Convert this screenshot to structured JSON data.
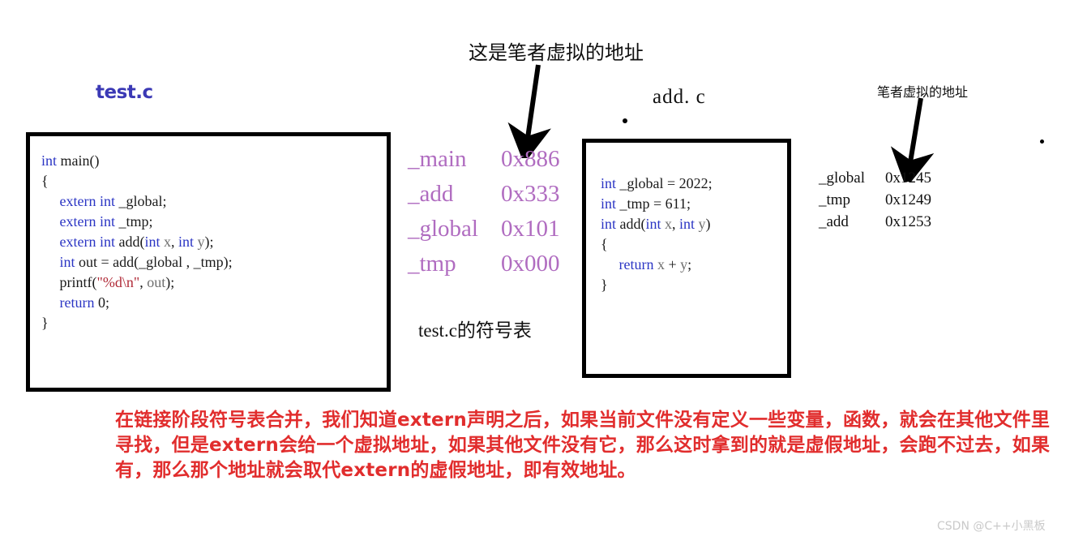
{
  "titles": {
    "left_file": "test.c",
    "right_file": "add. c"
  },
  "annotations": {
    "left_arrow_label": "这是笔者虚拟的地址",
    "right_arrow_label": "笔者虚拟的地址"
  },
  "code_testc": {
    "lines": [
      [
        {
          "t": "int ",
          "c": "kw"
        },
        {
          "t": "main()",
          "c": "pl"
        }
      ],
      [
        {
          "t": "{",
          "c": "pl"
        }
      ],
      [
        {
          "t": "     ",
          "c": "pl"
        },
        {
          "t": "extern int ",
          "c": "kw"
        },
        {
          "t": "_global;",
          "c": "pl"
        }
      ],
      [
        {
          "t": "     ",
          "c": "pl"
        },
        {
          "t": "extern int ",
          "c": "kw"
        },
        {
          "t": "_tmp;",
          "c": "pl"
        }
      ],
      [
        {
          "t": "     ",
          "c": "pl"
        },
        {
          "t": "extern int ",
          "c": "kw"
        },
        {
          "t": "add(",
          "c": "pl"
        },
        {
          "t": "int ",
          "c": "kw"
        },
        {
          "t": "x",
          "c": "var"
        },
        {
          "t": ", ",
          "c": "pl"
        },
        {
          "t": "int ",
          "c": "kw"
        },
        {
          "t": "y",
          "c": "var"
        },
        {
          "t": ");",
          "c": "pl"
        }
      ],
      [
        {
          "t": "     ",
          "c": "pl"
        },
        {
          "t": "int ",
          "c": "kw"
        },
        {
          "t": "out = add(_global , _tmp);",
          "c": "pl"
        }
      ],
      [
        {
          "t": "     ",
          "c": "pl"
        },
        {
          "t": "printf(",
          "c": "pl"
        },
        {
          "t": "\"%d\\n\"",
          "c": "str"
        },
        {
          "t": ", ",
          "c": "pl"
        },
        {
          "t": "out",
          "c": "var"
        },
        {
          "t": ");",
          "c": "pl"
        }
      ],
      [
        {
          "t": "     ",
          "c": "pl"
        },
        {
          "t": "return ",
          "c": "kw"
        },
        {
          "t": "0;",
          "c": "pl"
        }
      ],
      [
        {
          "t": "}",
          "c": "pl"
        }
      ]
    ]
  },
  "code_addc": {
    "lines": [
      [
        {
          "t": "int ",
          "c": "kw"
        },
        {
          "t": "_global = 2022;",
          "c": "pl"
        }
      ],
      [
        {
          "t": "int ",
          "c": "kw"
        },
        {
          "t": "_tmp = 611;",
          "c": "pl"
        }
      ],
      [
        {
          "t": "int ",
          "c": "kw"
        },
        {
          "t": "add(",
          "c": "pl"
        },
        {
          "t": "int ",
          "c": "kw"
        },
        {
          "t": "x",
          "c": "var"
        },
        {
          "t": ", ",
          "c": "pl"
        },
        {
          "t": "int ",
          "c": "kw"
        },
        {
          "t": "y",
          "c": "var"
        },
        {
          "t": ")",
          "c": "pl"
        }
      ],
      [
        {
          "t": "{",
          "c": "pl"
        }
      ],
      [
        {
          "t": "     ",
          "c": "pl"
        },
        {
          "t": "return ",
          "c": "kw"
        },
        {
          "t": "x",
          "c": "var"
        },
        {
          "t": " + ",
          "c": "pl"
        },
        {
          "t": "y",
          "c": "var"
        },
        {
          "t": ";",
          "c": "pl"
        }
      ],
      [
        {
          "t": "}",
          "c": "pl"
        }
      ]
    ]
  },
  "symbol_table_testc": {
    "caption": "test.c的符号表",
    "color": "#b06cc0",
    "rows": [
      {
        "symbol": "_main",
        "address": "0x886"
      },
      {
        "symbol": "_add",
        "address": "0x333"
      },
      {
        "symbol": "_global",
        "address": "0x101"
      },
      {
        "symbol": "_tmp",
        "address": "0x000"
      }
    ]
  },
  "symbol_table_addc": {
    "rows": [
      {
        "symbol": "_global",
        "address": "0x1245"
      },
      {
        "symbol": "_tmp",
        "address": "0x1249"
      },
      {
        "symbol": "_add",
        "address": "0x1253"
      }
    ]
  },
  "note": {
    "text": "在链接阶段符号表合并，我们知道extern声明之后，如果当前文件没有定义一些变量，函数，就会在其他文件里寻找，但是extern会给一个虚拟地址，如果其他文件没有它，那么这时拿到的就是虚假地址，会跑不过去，如果有，那么那个地址就会取代extern的虚假地址，即有效地址。",
    "color": "#e12d2d"
  },
  "watermark": {
    "text": "CSDN @C++小黑板"
  }
}
